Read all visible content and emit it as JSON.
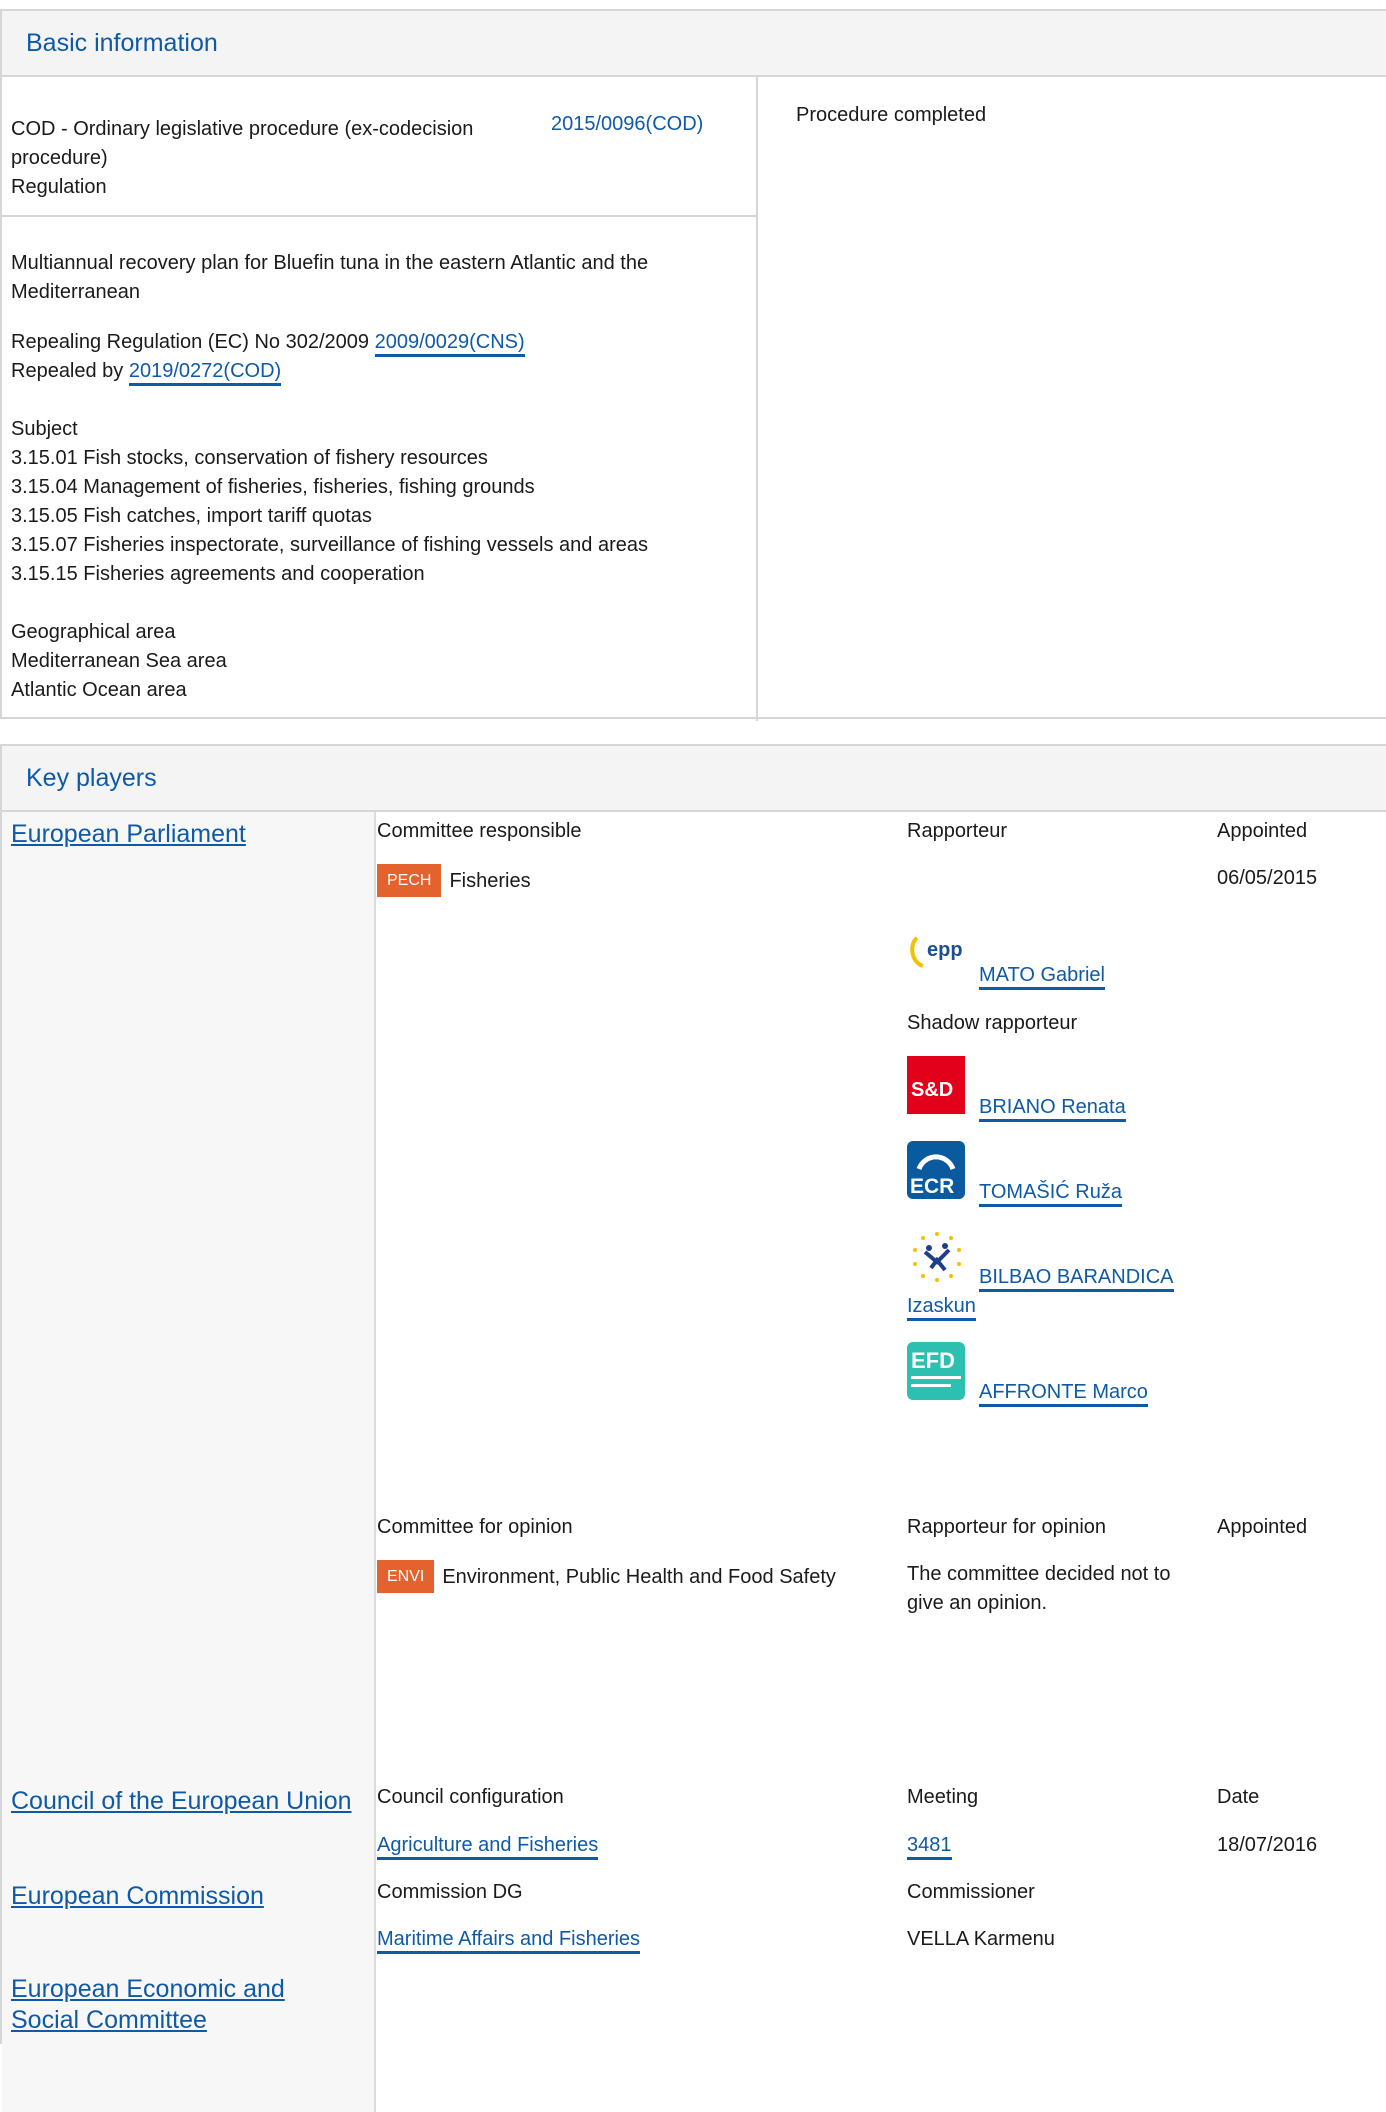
{
  "basic": {
    "heading": "Basic information",
    "procedure_type": "COD - Ordinary legislative procedure (ex-codecision procedure)",
    "instrument": "Regulation",
    "reference": "2015/0096(COD)",
    "status": "Procedure completed",
    "title": "Multiannual recovery plan for Bluefin tuna in the eastern Atlantic and the Mediterranean",
    "repealing_prefix": "Repealing Regulation (EC) No 302/2009",
    "repealing_ref": "2009/0029(CNS)",
    "repealed_prefix": "Repealed by",
    "repealed_ref": "2019/0272(COD)",
    "subject_label": "Subject",
    "subjects": [
      "3.15.01 Fish stocks, conservation of fishery resources",
      "3.15.04 Management of fisheries, fisheries, fishing grounds",
      "3.15.05 Fish catches, import tariff quotas",
      "3.15.07 Fisheries inspectorate, surveillance of fishing vessels and areas",
      "3.15.15 Fisheries agreements and cooperation"
    ],
    "geo_label": "Geographical area",
    "geo_areas": [
      "Mediterranean Sea area",
      "Atlantic Ocean area"
    ]
  },
  "key_players": {
    "heading": "Key players",
    "ep": {
      "name": "European Parliament",
      "col_committee": "Committee responsible",
      "col_rapporteur": "Rapporteur",
      "col_appointed": "Appointed",
      "committee_code": "PECH",
      "committee_name": "Fisheries",
      "appointed_date": "06/05/2015",
      "rapporteur": {
        "name": "MATO Gabriel",
        "group_logo": "epp",
        "group_label": "epp"
      },
      "shadow_label": "Shadow rapporteur",
      "shadows": [
        {
          "name": "BRIANO Renata",
          "group_logo": "s-and-d",
          "group_label": "S&D"
        },
        {
          "name": "TOMAŠIĆ Ruža",
          "group_logo": "ecr",
          "group_label": "ECR"
        },
        {
          "name_line1": "BILBAO BARANDICA",
          "name_line2": "Izaskun",
          "group_logo": "alde"
        },
        {
          "name": "AFFRONTE Marco",
          "group_logo": "efdd",
          "group_label": "EFD"
        }
      ],
      "col_opinion": "Committee for opinion",
      "col_opinion_rapporteur": "Rapporteur for opinion",
      "col_opinion_appointed": "Appointed",
      "opinion_code": "ENVI",
      "opinion_name": "Environment, Public Health and Food Safety",
      "opinion_note_line1": "The committee decided not to",
      "opinion_note_line2": "give an opinion.",
      "colors": {
        "pech_badge": "#e3622e",
        "envi_badge": "#e3622e",
        "link": "#0e5aa7"
      }
    },
    "council": {
      "name": "Council of the European Union",
      "col_config": "Council configuration",
      "col_meeting": "Meeting",
      "col_date": "Date",
      "config": "Agriculture and Fisheries",
      "meeting": "3481",
      "date": "18/07/2016"
    },
    "commission": {
      "name": "European Commission",
      "col_dg": "Commission DG",
      "col_commissioner": "Commissioner",
      "dg": "Maritime Affairs and Fisheries",
      "commissioner": "VELLA Karmenu"
    },
    "eesc": {
      "name_line1": "European Economic and",
      "name_line2": "Social Committee"
    }
  }
}
